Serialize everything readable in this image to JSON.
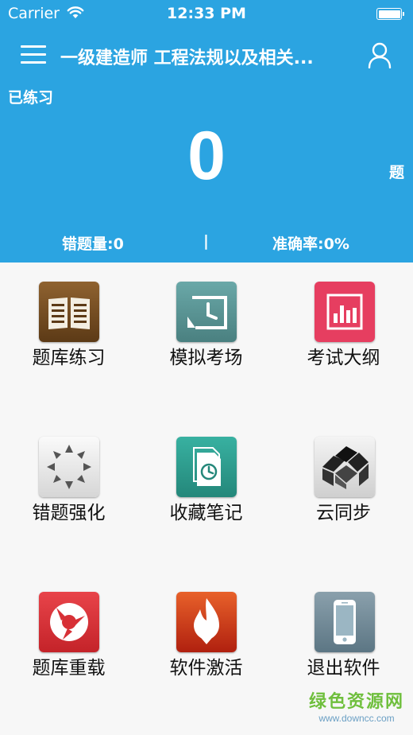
{
  "status_bar": {
    "carrier": "Carrier",
    "time": "12:33 PM",
    "wifi_icon": "wifi-icon",
    "battery_icon": "battery-icon"
  },
  "nav": {
    "menu_icon": "menu-icon",
    "title": "一级建造师 工程法规以及相关...",
    "user_icon": "user-icon"
  },
  "summary": {
    "practiced_label": "已练习",
    "count": "0",
    "unit": "题",
    "wrong_count": "错题量:0",
    "separator": "|",
    "accuracy": "准确率:0%"
  },
  "menu": [
    {
      "label": "题库练习",
      "icon": "book-icon",
      "color": "#7a4e22"
    },
    {
      "label": "模拟考场",
      "icon": "clock-icon",
      "color": "#5a9696"
    },
    {
      "label": "考试大纲",
      "icon": "chart-icon",
      "color": "#e63e60"
    },
    {
      "label": "错题强化",
      "icon": "sun-icon",
      "color": "#e0e0e0"
    },
    {
      "label": "收藏笔记",
      "icon": "document-clock-icon",
      "color": "#2f9d8e"
    },
    {
      "label": "云同步",
      "icon": "cubes-icon",
      "color": "#222222"
    },
    {
      "label": "题库重载",
      "icon": "reload-icon",
      "color": "#d73036"
    },
    {
      "label": "软件激活",
      "icon": "flame-icon",
      "color": "#c8331a"
    },
    {
      "label": "退出软件",
      "icon": "phone-icon",
      "color": "#6c8593"
    }
  ],
  "watermark": {
    "main": "绿色资源网",
    "sub": "www.downcc.com"
  },
  "colors": {
    "header_bg": "#2ba4e1",
    "body_bg": "#f7f7f7"
  }
}
